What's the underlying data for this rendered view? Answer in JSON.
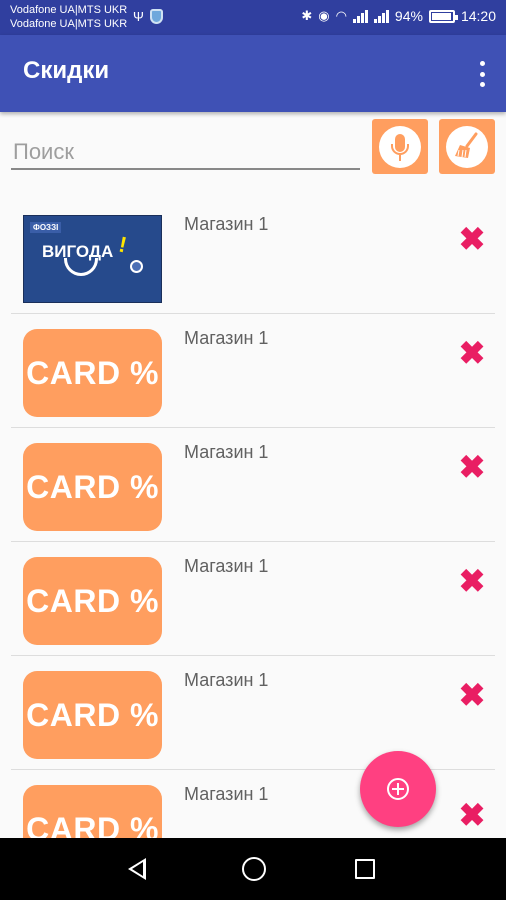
{
  "status_bar": {
    "carrier_1": "Vodafone UA|MTS UKR",
    "carrier_2": "Vodafone UA|MTS UKR",
    "battery_percent": "94%",
    "battery_level": 0.94,
    "time": "14:20",
    "icons": [
      "usb-icon",
      "shield-icon",
      "bluetooth-icon",
      "eye-icon",
      "wifi-icon",
      "signal-icon",
      "battery-icon"
    ]
  },
  "appbar": {
    "title": "Скидки"
  },
  "search": {
    "placeholder": "Поиск"
  },
  "cards": [
    {
      "image": "vygoda-card",
      "image_text": "ВИГОДА",
      "image_brand": "ФОЗЗІ",
      "store": "Магазин 1"
    },
    {
      "image": "card-percent",
      "image_text": "CARD %",
      "store": "Магазин 1"
    },
    {
      "image": "card-percent",
      "image_text": "CARD %",
      "store": "Магазин 1"
    },
    {
      "image": "card-percent",
      "image_text": "CARD %",
      "store": "Магазин 1"
    },
    {
      "image": "card-percent",
      "image_text": "CARD %",
      "store": "Магазин 1"
    },
    {
      "image": "card-percent",
      "image_text": "CARD %",
      "store": "Магазин 1"
    }
  ],
  "colors": {
    "status_bar": "#303f9f",
    "app_bar": "#3f51b5",
    "accent_orange": "#ff9e5f",
    "delete_pink": "#e91e63",
    "fab_pink": "#ff4081"
  }
}
